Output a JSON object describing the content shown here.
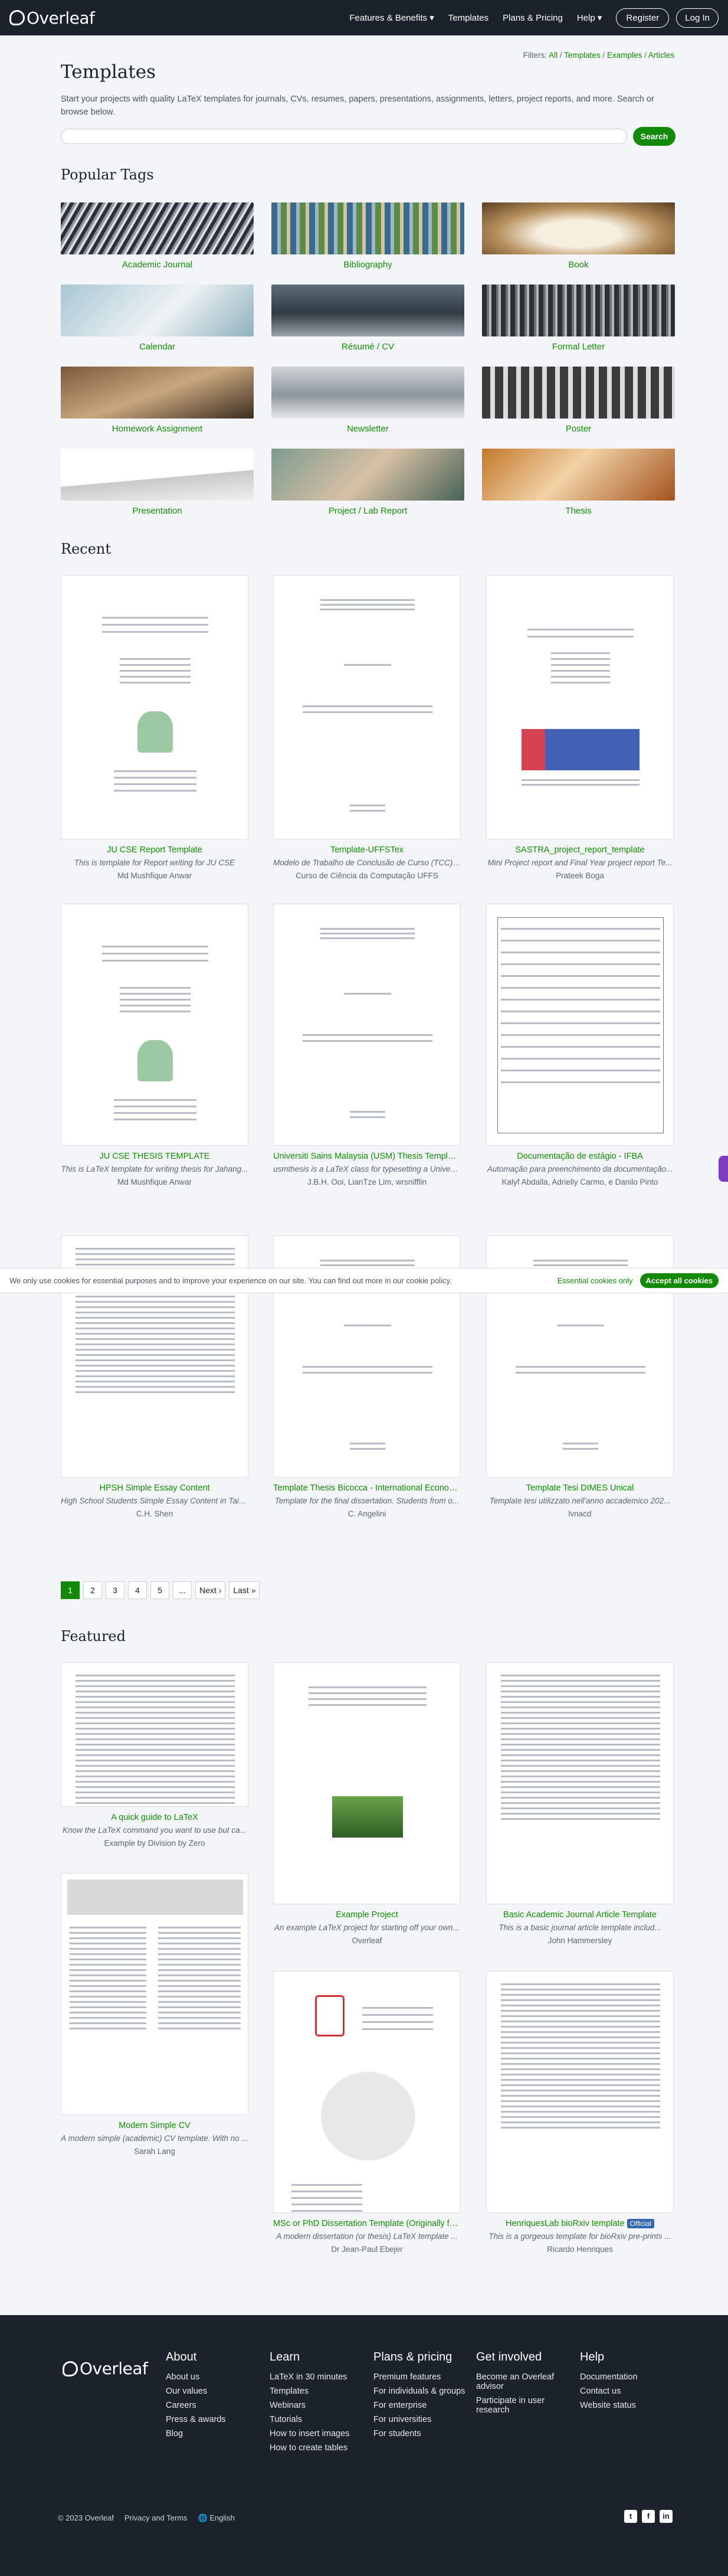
{
  "header": {
    "logo": "Overleaf",
    "nav": [
      "Features & Benefits",
      "Templates",
      "Plans & Pricing",
      "Help"
    ],
    "register": "Register",
    "login": "Log In"
  },
  "filters": {
    "prefix": "Filters:",
    "all": "All",
    "templates": "Templates",
    "examples": "Examples",
    "articles": "Articles"
  },
  "page": {
    "title": "Templates",
    "description": "Start your projects with quality LaTeX templates for journals, CVs, resumes, papers, presentations, assignments, letters, project reports, and more. Search or browse below.",
    "search_button": "Search"
  },
  "popular_tags": {
    "heading": "Popular Tags",
    "items": [
      "Academic Journal",
      "Bibliography",
      "Book",
      "Calendar",
      "Résumé / CV",
      "Formal Letter",
      "Homework Assignment",
      "Newsletter",
      "Poster",
      "Presentation",
      "Project / Lab Report",
      "Thesis"
    ]
  },
  "recent": {
    "heading": "Recent",
    "cards": [
      {
        "title": "JU CSE Report Template",
        "desc": "This is template for Report writing for JU CSE",
        "author": "Md Mushfique Anwar"
      },
      {
        "title": "Template-UFFSTex",
        "desc": "Modelo de Trabalho de Conclusão de Curso (TCC) ...",
        "author": "Curso de Ciência da Computação UFFS"
      },
      {
        "title": "SASTRA_project_report_template",
        "desc": "Mini Project report and Final Year project report Te...",
        "author": "Prateek Boga"
      },
      {
        "title": "JU CSE THESIS TEMPLATE",
        "desc": "This is LaTeX template for writing thesis for Jahang...",
        "author": "Md Mushfique Anwar"
      },
      {
        "title": "Universiti Sains Malaysia (USM) Thesis Templat...",
        "desc": "usmthesis is a LaTeX class for typesetting a Univers...",
        "author": "J.B.H. Ooi, LianTze Lim, wrsnifflin"
      },
      {
        "title": "Documentação de estágio - IFBA",
        "desc": "Automação para preenchimento da documentação...",
        "author": "Kalyf Abdalla, Adrielly Carmo, e Danilo Pinto"
      },
      {
        "title": "HPSH Simple Essay Content",
        "desc": "High School Students Simple Essay Content in Taiw...",
        "author": "C.H. Shen"
      },
      {
        "title": "Template Thesis Bicocca - International Econom...",
        "desc": "Template for the final dissertation. Students from o...",
        "author": "C. Angelini"
      },
      {
        "title": "Template Tesi DIMES Unical",
        "desc": "Template tesi utilizzato nell'anno accademico 202...",
        "author": "lvnacd"
      }
    ]
  },
  "cookie": {
    "text": "We only use cookies for essential purposes and to improve your experience on our site. You can find out more in our cookie policy.",
    "essential": "Essential cookies only",
    "accept": "Accept all cookies"
  },
  "pagination": [
    "1",
    "2",
    "3",
    "4",
    "5",
    "...",
    "Next ›",
    "Last »"
  ],
  "featured": {
    "heading": "Featured",
    "cards": [
      {
        "title": "A quick guide to LaTeX",
        "desc": "Know the LaTeX command you want to use but ca...",
        "author": "Example by Division by Zero"
      },
      {
        "title": "Example Project",
        "desc": "An example LaTeX project for starting off your own...",
        "author": "Overleaf"
      },
      {
        "title": "Basic Academic Journal Article Template",
        "desc": "This is a basic journal article template includ...",
        "author": "John Hammersley"
      },
      {
        "title": "Modern Simple CV",
        "desc": "A modern simple (academic) CV template. With no ...",
        "author": "Sarah Lang"
      },
      {
        "title": "MSc or PhD Dissertation Template (Originally fo...",
        "desc": "A modern dissertation (or thesis) LaTeX template ...",
        "author": "Dr Jean-Paul Ebejer"
      },
      {
        "title": "HenriquesLab bioRxiv template",
        "badge": "Official",
        "desc": "This is a gorgeous template for bioRxiv pre-prints ...",
        "author": "Ricardo Henriques"
      }
    ]
  },
  "footer": {
    "logo": "Overleaf",
    "columns": [
      {
        "heading": "About",
        "links": [
          "About us",
          "Our values",
          "Careers",
          "Press & awards",
          "Blog"
        ]
      },
      {
        "heading": "Learn",
        "links": [
          "LaTeX in 30 minutes",
          "Templates",
          "Webinars",
          "Tutorials",
          "How to insert images",
          "How to create tables"
        ]
      },
      {
        "heading": "Plans & pricing",
        "links": [
          "Premium features",
          "For individuals & groups",
          "For enterprise",
          "For universities",
          "For students"
        ]
      },
      {
        "heading": "Get involved",
        "links": [
          "Become an Overleaf advisor",
          "Participate in user research"
        ]
      },
      {
        "heading": "Help",
        "links": [
          "Documentation",
          "Contact us",
          "Website status"
        ]
      }
    ],
    "copyright": "© 2023 Overleaf",
    "privacy": "Privacy and Terms",
    "language": "English"
  }
}
